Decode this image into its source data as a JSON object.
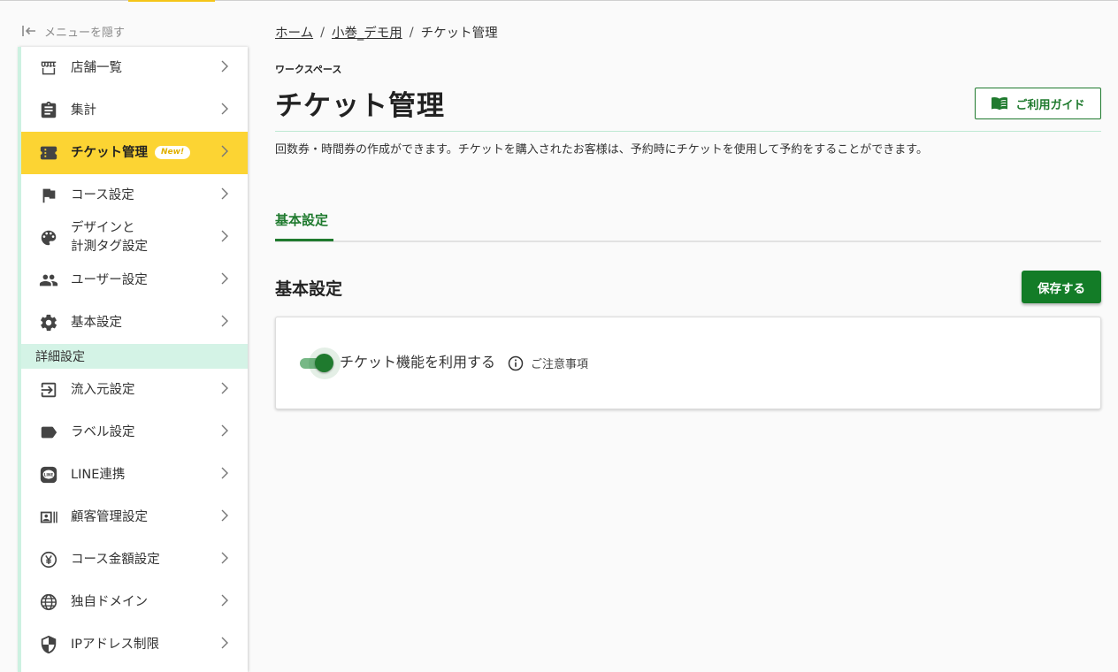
{
  "hide_menu": {
    "label": "メニューを隠す"
  },
  "sidebar": {
    "items_top": [
      {
        "label": "店舗一覧",
        "icon": "store-icon"
      },
      {
        "label": "集計",
        "icon": "clipboard-icon"
      },
      {
        "label": "チケット管理",
        "icon": "ticket-icon",
        "badge": "New!",
        "active": true
      },
      {
        "label": "コース設定",
        "icon": "flag-icon"
      },
      {
        "label": "デザインと\n計測タグ設定",
        "icon": "palette-icon"
      },
      {
        "label": "ユーザー設定",
        "icon": "people-icon"
      },
      {
        "label": "基本設定",
        "icon": "gear-icon"
      }
    ],
    "section_header": "詳細設定",
    "items_detail": [
      {
        "label": "流入元設定",
        "icon": "login-icon"
      },
      {
        "label": "ラベル設定",
        "icon": "label-icon"
      },
      {
        "label": "LINE連携",
        "icon": "line-icon"
      },
      {
        "label": "顧客管理設定",
        "icon": "contact-card-icon"
      },
      {
        "label": "コース金額設定",
        "icon": "yen-icon"
      },
      {
        "label": "独自ドメイン",
        "icon": "globe-icon"
      },
      {
        "label": "IPアドレス制限",
        "icon": "shield-icon"
      }
    ]
  },
  "breadcrumb": {
    "home": "ホーム",
    "store": "小巻_デモ用",
    "current": "チケット管理",
    "sep": "/"
  },
  "header": {
    "workspace_label": "ワークスペース",
    "title": "チケット管理",
    "guide_label": "ご利用ガイド",
    "description": "回数券・時間券の作成ができます。チケットを購入されたお客様は、予約時にチケットを使用して予約をすることができます。"
  },
  "tabs": [
    {
      "label": "基本設定",
      "active": true
    }
  ],
  "section": {
    "title": "基本設定",
    "save_label": "保存する",
    "toggle_label": "チケット機能を利用する",
    "toggle_on": true,
    "notice_label": "ご注意事項"
  },
  "colors": {
    "accent_green": "#1f7a2e",
    "active_yellow": "#fcd433",
    "section_mint": "#d4f3e6"
  }
}
